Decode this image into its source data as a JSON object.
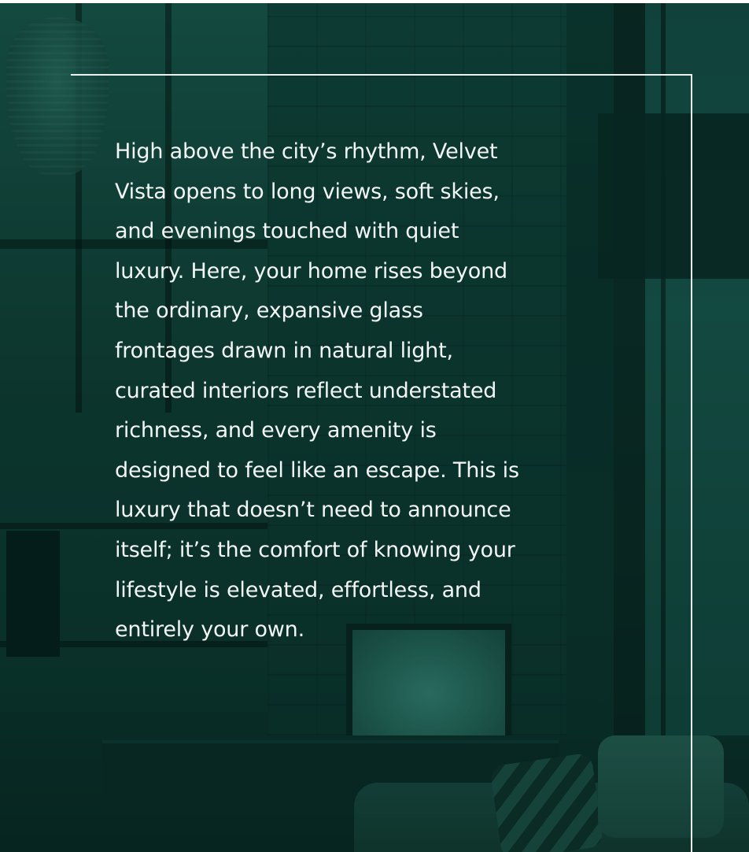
{
  "colors": {
    "background_tint": "#0a302a",
    "frame_line": "#e9f1ee",
    "text": "#f2f6f4"
  },
  "body_lines": [
    "High above the city’s rhythm, Velvet",
    "Vista opens to long views, soft skies,",
    "and evenings touched with quiet",
    "luxury. Here, your home rises beyond",
    "the ordinary, expansive glass",
    "frontages drawn in natural light,",
    "curated interiors reflect understated",
    "richness, and every amenity is",
    "designed to feel like an escape. This is",
    "luxury that doesn’t need to announce",
    "itself; it’s the comfort of knowing your",
    "lifestyle is elevated, effortless, and",
    "entirely your own."
  ]
}
